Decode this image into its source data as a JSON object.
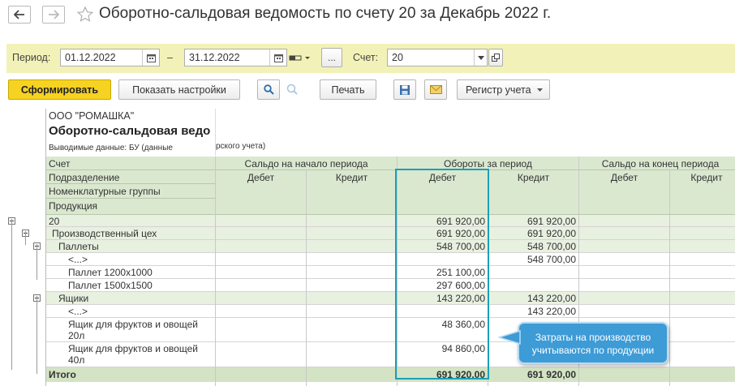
{
  "window": {
    "title": "Оборотно-сальдовая ведомость по счету 20 за Декабрь 2022 г."
  },
  "period_bar": {
    "period_label": "Период:",
    "date_from": "01.12.2022",
    "dash": "–",
    "date_to": "31.12.2022",
    "dots_label": "...",
    "account_label": "Счет:",
    "account_value": "20"
  },
  "toolbar": {
    "generate": "Сформировать",
    "show_settings": "Показать настройки",
    "print": "Печать",
    "register": "Регистр учета"
  },
  "report": {
    "org": "ООО \"РОМАШКА\"",
    "title": "Оборотно-сальдовая ведо",
    "output_data": "Выводимые данные: БУ (данные",
    "output_data_rest": "рского учета)",
    "row_headers": [
      "Счет",
      "Подразделение",
      "Номенклатурные группы",
      "Продукция"
    ],
    "col_groups": [
      "Сальдо на начало периода",
      "Обороты за период",
      "Сальдо на конец периода"
    ],
    "sub_cols": [
      "Дебет",
      "Кредит",
      "Дебет",
      "Кредит",
      "Дебет",
      "Кредит"
    ],
    "rows": [
      {
        "name": "20",
        "turn_debit": "691 920,00",
        "turn_credit": "691 920,00"
      },
      {
        "name": "Производственный цех",
        "turn_debit": "691 920,00",
        "turn_credit": "691 920,00"
      },
      {
        "name": "Паллеты",
        "turn_debit": "548 700,00",
        "turn_credit": "548 700,00"
      },
      {
        "name": "<...>",
        "turn_debit": "",
        "turn_credit": "548 700,00"
      },
      {
        "name": "Паллет 1200х1000",
        "turn_debit": "251 100,00",
        "turn_credit": ""
      },
      {
        "name": "Паллет 1500х1500",
        "turn_debit": "297 600,00",
        "turn_credit": ""
      },
      {
        "name": "Ящики",
        "turn_debit": "143 220,00",
        "turn_credit": "143 220,00"
      },
      {
        "name": "<...>",
        "turn_debit": "",
        "turn_credit": "143 220,00"
      },
      {
        "name_line1": "Ящик для фруктов и овощей",
        "name_line2": "20л",
        "turn_debit": "48 360,00",
        "turn_credit": ""
      },
      {
        "name_line1": "Ящик для фруктов и овощей",
        "name_line2": "40л",
        "turn_debit": "94 860,00",
        "turn_credit": ""
      }
    ],
    "total": {
      "name": "Итого",
      "turn_debit": "691 920,00",
      "turn_credit": "691 920,00"
    }
  },
  "callout": {
    "text": "Затраты на производство учитываются по продукции"
  },
  "colors": {
    "accent_yellow": "#f6d222",
    "period_bar": "#f2f2b8",
    "highlight": "#1aa0b8",
    "callout": "#3d9bd6",
    "header_green": "#dbe8d0"
  }
}
